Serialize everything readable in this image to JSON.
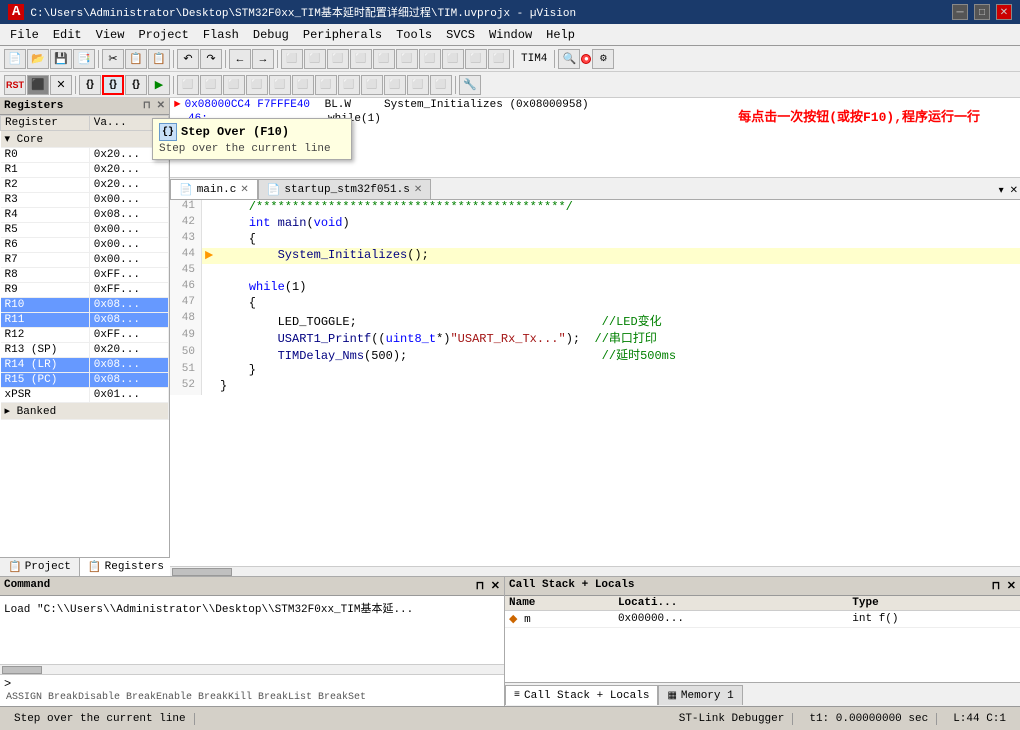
{
  "titleBar": {
    "title": "C:\\Users\\Administrator\\Desktop\\STM32F0xx_TIM基本延时配置详细过程\\TIM.uvprojx - µVision",
    "minimizeBtn": "─",
    "maximizeBtn": "□",
    "closeBtn": "✕"
  },
  "menuBar": {
    "items": [
      "File",
      "Edit",
      "View",
      "Project",
      "Flash",
      "Debug",
      "Peripherals",
      "Tools",
      "SVCS",
      "Window",
      "Help"
    ]
  },
  "toolbar1": {
    "buttons": [
      "📄",
      "📁",
      "💾",
      "✂",
      "📋",
      "📑",
      "↶",
      "↷",
      "←",
      "→",
      "⚑",
      "⚑",
      "⚑",
      "⚑",
      "⚑",
      "⚑",
      "⚑",
      "⚑",
      "⚑",
      "⚑",
      "⚑",
      "⚑",
      "⚑"
    ],
    "tim4Label": "TIM4"
  },
  "toolbar2": {
    "buttons": [
      "RST",
      "⬛",
      "✕",
      "{}",
      "{}",
      "{}",
      "▶",
      "⬜",
      "⬜",
      "⬜",
      "⬜",
      "⬜",
      "⬜",
      "⬜",
      "⬜",
      "⬜",
      "⬜",
      "⬜",
      "⬜",
      "⬜",
      "⬜",
      "⬜",
      "🔧"
    ]
  },
  "tooltip": {
    "icon": "{}",
    "title": "Step Over (F10)",
    "description": "Step over the current line"
  },
  "registersPanel": {
    "title": "Registers",
    "columns": [
      "Register",
      "Value"
    ],
    "coreLabel": "Core",
    "registers": [
      {
        "name": "R0",
        "value": "0x20...",
        "highlight": false
      },
      {
        "name": "R1",
        "value": "0x20...",
        "highlight": false
      },
      {
        "name": "R2",
        "value": "0x20...",
        "highlight": false
      },
      {
        "name": "R3",
        "value": "0x00...",
        "highlight": false
      },
      {
        "name": "R4",
        "value": "0x08...",
        "highlight": false
      },
      {
        "name": "R5",
        "value": "0x00...",
        "highlight": false
      },
      {
        "name": "R6",
        "value": "0x00...",
        "highlight": false
      },
      {
        "name": "R7",
        "value": "0x00...",
        "highlight": false
      },
      {
        "name": "R8",
        "value": "0xFF...",
        "highlight": false
      },
      {
        "name": "R9",
        "value": "0xFF...",
        "highlight": false
      },
      {
        "name": "R10",
        "value": "0x08...",
        "highlight": true
      },
      {
        "name": "R11",
        "value": "0x08...",
        "highlight": true
      },
      {
        "name": "R12",
        "value": "0xFF...",
        "highlight": false
      },
      {
        "name": "R13 (SP)",
        "value": "0x20...",
        "highlight": false
      },
      {
        "name": "R14 (LR)",
        "value": "0x08...",
        "highlight": true
      },
      {
        "name": "R15 (PC)",
        "value": "0x08...",
        "highlight": true
      },
      {
        "name": "xPSR",
        "value": "0x01...",
        "highlight": false
      }
    ],
    "bankedLabel": "Banked",
    "tabs": [
      "Project",
      "Registers"
    ]
  },
  "asmView": {
    "lines": [
      {
        "addr": "0x08000CC4 F7FFFE40",
        "instruction": "BL.W    System_Initializes (0x08000958)",
        "isCurrent": true
      },
      {
        "addr": "46:",
        "instruction": "while(1)",
        "isCurrent": false
      }
    ],
    "annotation": "每点击一次按钮(或按F10),程序运行一行"
  },
  "codeTabs": [
    {
      "label": "main.c",
      "active": true,
      "icon": "📄"
    },
    {
      "label": "startup_stm32f051.s",
      "active": false,
      "icon": "📄"
    }
  ],
  "codeLines": [
    {
      "num": 41,
      "content": "    /*******************************************/",
      "active": false,
      "hasArrow": false
    },
    {
      "num": 42,
      "content": "    int main(void)",
      "active": false,
      "hasArrow": false
    },
    {
      "num": 43,
      "content": "    {",
      "active": false,
      "hasArrow": false
    },
    {
      "num": 44,
      "content": "        System_Initializes();",
      "active": true,
      "hasArrow": true
    },
    {
      "num": 45,
      "content": "",
      "active": false,
      "hasArrow": false
    },
    {
      "num": 46,
      "content": "    while(1)",
      "active": false,
      "hasArrow": false
    },
    {
      "num": 47,
      "content": "    {",
      "active": false,
      "hasArrow": false
    },
    {
      "num": 48,
      "content": "        LED_TOGGLE;                                  //LED变化",
      "active": false,
      "hasArrow": false
    },
    {
      "num": 49,
      "content": "        USART1_Printf((uint8_t*)\"USART_Rx_Tx...\");  //串口打印",
      "active": false,
      "hasArrow": false
    },
    {
      "num": 50,
      "content": "        TIMDelay_Nms(500);                           //延时500ms",
      "active": false,
      "hasArrow": false
    },
    {
      "num": 51,
      "content": "    }",
      "active": false,
      "hasArrow": false
    },
    {
      "num": 52,
      "content": "}",
      "active": false,
      "hasArrow": false
    }
  ],
  "commandPanel": {
    "title": "Command",
    "content": "Load \"C:\\\\Users\\\\Administrator\\\\Desktop\\\\STM32F0xx_TIM基本延...",
    "assignLine": "ASSIGN BreakDisable BreakEnable BreakKill BreakList BreakSet",
    "prompt": ">"
  },
  "callStackPanel": {
    "title": "Call Stack + Locals",
    "columns": [
      "Name",
      "Locati...",
      "Type"
    ],
    "rows": [
      {
        "name": "m",
        "location": "0x00000...",
        "type": "int f()"
      }
    ]
  },
  "bottomTabs": [
    {
      "label": "Call Stack + Locals",
      "active": true,
      "icon": "≡"
    },
    {
      "label": "Memory 1",
      "active": false,
      "icon": "▦"
    }
  ],
  "statusBar": {
    "message": "Step over the current line",
    "debugger": "ST-Link Debugger",
    "time": "t1: 0.00000000 sec",
    "position": "L:44 C:1"
  }
}
